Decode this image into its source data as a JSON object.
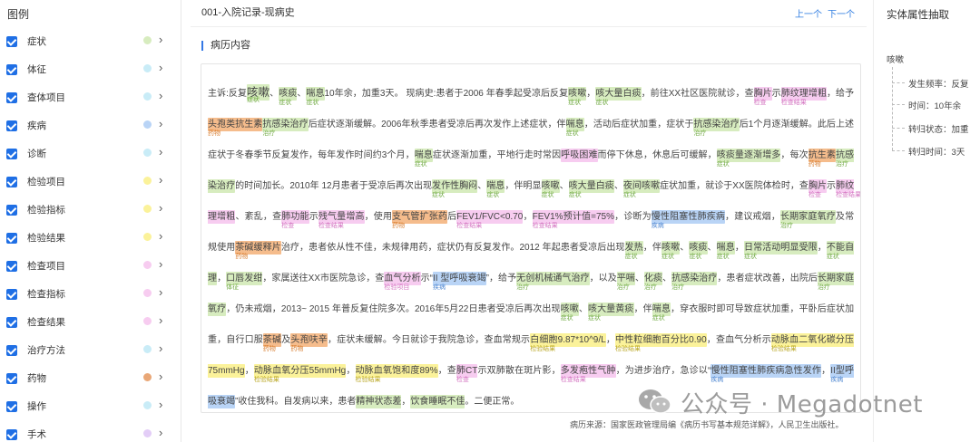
{
  "legend": {
    "title": "图例",
    "items": [
      {
        "label": "症状",
        "color": "#d7ecbf"
      },
      {
        "label": "体征",
        "color": "#c9ecf7"
      },
      {
        "label": "查体项目",
        "color": "#c9ecf7"
      },
      {
        "label": "疾病",
        "color": "#b9d4f6"
      },
      {
        "label": "诊断",
        "color": "#c9ecf7"
      },
      {
        "label": "检验项目",
        "color": "#fbf29a"
      },
      {
        "label": "检验指标",
        "color": "#fbf29a"
      },
      {
        "label": "检验结果",
        "color": "#fbf29a"
      },
      {
        "label": "检查项目",
        "color": "#f7ccf0"
      },
      {
        "label": "检查指标",
        "color": "#f7ccf0"
      },
      {
        "label": "检查结果",
        "color": "#f7ccf0"
      },
      {
        "label": "治疗方法",
        "color": "#c9ecf7"
      },
      {
        "label": "药物",
        "color": "#e9a777"
      },
      {
        "label": "操作",
        "color": "#c9ecf7"
      },
      {
        "label": "手术",
        "color": "#e3cdf7"
      }
    ]
  },
  "header": {
    "title": "001-入院记录-现病史",
    "prev_label": "上一个",
    "next_label": "下一个"
  },
  "section_title": "病历内容",
  "record": [
    {
      "t": "主诉:反复"
    },
    {
      "t": "咳嗽",
      "c": "sym",
      "tag": "症状",
      "big": true
    },
    {
      "t": "、"
    },
    {
      "t": "咳痰",
      "c": "sym",
      "tag": "症状"
    },
    {
      "t": "、"
    },
    {
      "t": "喘息",
      "c": "sym",
      "tag": "症状"
    },
    {
      "t": "10年余，加重3天。 现病史:患者于2006 年春季起受凉后反复"
    },
    {
      "t": "咳嗽",
      "c": "sym",
      "tag": "症状"
    },
    {
      "t": "，"
    },
    {
      "t": "咳大量白痰",
      "c": "sym",
      "tag": "症状"
    },
    {
      "t": "，前往XX社区医院就诊，查"
    },
    {
      "t": "胸片",
      "c": "chk",
      "tag": "检查"
    },
    {
      "t": "示"
    },
    {
      "t": "肺纹理增粗",
      "c": "chk",
      "tag": "检查结果"
    },
    {
      "t": "，给予"
    },
    {
      "t": "头孢类抗生素",
      "c": "drg",
      "tag": "药物"
    },
    {
      "t": "抗感染治疗",
      "c": "sym",
      "tag": "治疗"
    },
    {
      "t": "后症状逐渐缓解。2006年秋季患者受凉后再次发作上述症状，伴"
    },
    {
      "t": "喘息",
      "c": "sym",
      "tag": "症状"
    },
    {
      "t": "，活动后症状加重，症状于"
    },
    {
      "t": "抗感染治疗",
      "c": "sym",
      "tag": "治疗"
    },
    {
      "t": "后1个月逐渐缓解。此后上述症状于冬春季节反复发作，每年发作时间约3个月，"
    },
    {
      "t": "喘息",
      "c": "sym",
      "tag": "症状"
    },
    {
      "t": "症状逐渐加重，平地行走时常因"
    },
    {
      "t": "呼吸困难",
      "c": "chk",
      "tag": ""
    },
    {
      "t": "而停下休息，休息后可缓解，"
    },
    {
      "t": "咳痰量逐渐增多",
      "c": "sym",
      "tag": "症状"
    },
    {
      "t": "，每次"
    },
    {
      "t": "抗生素",
      "c": "drg",
      "tag": "药物"
    },
    {
      "t": "抗感染治疗",
      "c": "sym",
      "tag": "治疗"
    },
    {
      "t": "的时间加长。2010年 12月患者于受凉后再次出现"
    },
    {
      "t": "发作性胸闷",
      "c": "sym",
      "tag": "症状"
    },
    {
      "t": "、"
    },
    {
      "t": "喘息",
      "c": "sym",
      "tag": "症状"
    },
    {
      "t": "，伴明显"
    },
    {
      "t": "咳嗽",
      "c": "sym",
      "tag": "症状"
    },
    {
      "t": "、"
    },
    {
      "t": "咳大量白痰",
      "c": "sym",
      "tag": "症状"
    },
    {
      "t": "、"
    },
    {
      "t": "夜间咳嗽",
      "c": "sym",
      "tag": "症状"
    },
    {
      "t": "症状加重，就诊于XX医院体检时，查"
    },
    {
      "t": "胸片",
      "c": "chk",
      "tag": "检查"
    },
    {
      "t": "示"
    },
    {
      "t": "肺纹理增粗",
      "c": "chk",
      "tag": "检查结果"
    },
    {
      "t": "、紊乱，查"
    },
    {
      "t": "肺功能",
      "c": "chk",
      "tag": "检查"
    },
    {
      "t": "示"
    },
    {
      "t": "残气量增高",
      "c": "chk",
      "tag": "检查结果"
    },
    {
      "t": "，使用"
    },
    {
      "t": "支气管扩张药",
      "c": "drg",
      "tag": "药物"
    },
    {
      "t": "后"
    },
    {
      "t": "FEV1/FVC<0.70",
      "c": "chk",
      "tag": "检查结果"
    },
    {
      "t": "，"
    },
    {
      "t": "FEV1%预计值=75%",
      "c": "chk",
      "tag": "检查结果"
    },
    {
      "t": "，诊断为"
    },
    {
      "t": "慢性阻塞性肺疾病",
      "c": "dis",
      "tag": "疾病"
    },
    {
      "t": "，建议戒烟，"
    },
    {
      "t": "长期家庭氧疗",
      "c": "sym",
      "tag": "治疗"
    },
    {
      "t": "及常规使用"
    },
    {
      "t": "茶碱缓释片",
      "c": "drg",
      "tag": "药物"
    },
    {
      "t": "治疗，患者依从性不佳，未规律用药，症状仍有反复发作。2012 年起患者受凉后出现"
    },
    {
      "t": "发热",
      "c": "sym",
      "tag": "症状"
    },
    {
      "t": "，伴"
    },
    {
      "t": "咳嗽",
      "c": "sym",
      "tag": "症状"
    },
    {
      "t": "、"
    },
    {
      "t": "咳痰",
      "c": "sym",
      "tag": "症状"
    },
    {
      "t": "、"
    },
    {
      "t": "喘息",
      "c": "sym",
      "tag": "症状"
    },
    {
      "t": "，"
    },
    {
      "t": "日常活动明显受限",
      "c": "sym",
      "tag": "症状"
    },
    {
      "t": "，"
    },
    {
      "t": "不能自理",
      "c": "sym",
      "tag": "症状"
    },
    {
      "t": "，"
    },
    {
      "t": "口唇发绀",
      "c": "sym",
      "tag": "体征"
    },
    {
      "t": "，家属送往XX市医院急诊，查"
    },
    {
      "t": "血气分析",
      "c": "chk",
      "tag": "检验项目"
    },
    {
      "t": "示“"
    },
    {
      "t": "II 型呼吸衰竭",
      "c": "dis",
      "tag": "疾病"
    },
    {
      "t": "”，给予"
    },
    {
      "t": "无创机械通气治疗",
      "c": "sym",
      "tag": "治疗"
    },
    {
      "t": "，以及"
    },
    {
      "t": "平喘",
      "c": "sym",
      "tag": "治疗"
    },
    {
      "t": "、"
    },
    {
      "t": "化痰",
      "c": "sym",
      "tag": "治疗"
    },
    {
      "t": "、"
    },
    {
      "t": "抗感染治疗",
      "c": "sym",
      "tag": "治疗"
    },
    {
      "t": "，患者症状改善，出院后"
    },
    {
      "t": "长期家庭氧疗",
      "c": "sym",
      "tag": "治疗"
    },
    {
      "t": "，仍未戒烟，2013~ 2015 年普反复住院多次。2016年5月22日患者受凉后再次出现"
    },
    {
      "t": "咳嗽",
      "c": "sym",
      "tag": "症状"
    },
    {
      "t": "、"
    },
    {
      "t": "咳大量黄痰",
      "c": "sym",
      "tag": "症状"
    },
    {
      "t": "，伴"
    },
    {
      "t": "喘息",
      "c": "sym",
      "tag": "症状"
    },
    {
      "t": "，穿衣服时即可导致症状加重，平卧后症状加重，自行口服"
    },
    {
      "t": "茶碱",
      "c": "drg",
      "tag": "药物"
    },
    {
      "t": "及"
    },
    {
      "t": "头孢呋辛",
      "c": "drg",
      "tag": "药物"
    },
    {
      "t": "，症状未缓解。今日就诊于我院急诊，查血常规示"
    },
    {
      "t": "白细胞9.87*10^9/L",
      "c": "res",
      "tag": "检验结果"
    },
    {
      "t": "，"
    },
    {
      "t": "中性粒细胞百分比0.90",
      "c": "res",
      "tag": "检验结果"
    },
    {
      "t": "，查血气分析示"
    },
    {
      "t": "动脉血二氧化碳分压75mmHg",
      "c": "res",
      "tag": "检验结果"
    },
    {
      "t": "，"
    },
    {
      "t": "动脉血氧分压55mmHg",
      "c": "res",
      "tag": "检验结果"
    },
    {
      "t": "，"
    },
    {
      "t": "动脉血氧饱和度89%",
      "c": "res",
      "tag": "检验结果"
    },
    {
      "t": "，查"
    },
    {
      "t": "肺CT",
      "c": "chk",
      "tag": "检查"
    },
    {
      "t": "示双肺散在斑片影，"
    },
    {
      "t": "多发疱性气肿",
      "c": "chk",
      "tag": "检查结果"
    },
    {
      "t": "，为进步治疗，急诊以“"
    },
    {
      "t": "慢性阻塞性肺疾病急性发作",
      "c": "dis",
      "tag": "疾病"
    },
    {
      "t": "，"
    },
    {
      "t": "II型呼吸衰竭",
      "c": "dis",
      "tag": "疾病"
    },
    {
      "t": "”收住我科。自发病以来，患者"
    },
    {
      "t": "精神状态差",
      "c": "sym",
      "tag": ""
    },
    {
      "t": "，"
    },
    {
      "t": "饮食睡眠不佳",
      "c": "sym",
      "tag": ""
    },
    {
      "t": "。二便正常。"
    }
  ],
  "source": "病历来源：国家医政管理局编《病历书写基本规范详解》，人民卫生出版社。",
  "right_panel": {
    "title": "实体属性抽取",
    "entity": "咳嗽",
    "attributes": [
      "发生频率：反复",
      "时间：10年余",
      "转归状态：加重",
      "转归时间：3天"
    ]
  },
  "watermark": {
    "text": "公众号 · Megadotnet",
    "icon": "wechat-icon"
  }
}
